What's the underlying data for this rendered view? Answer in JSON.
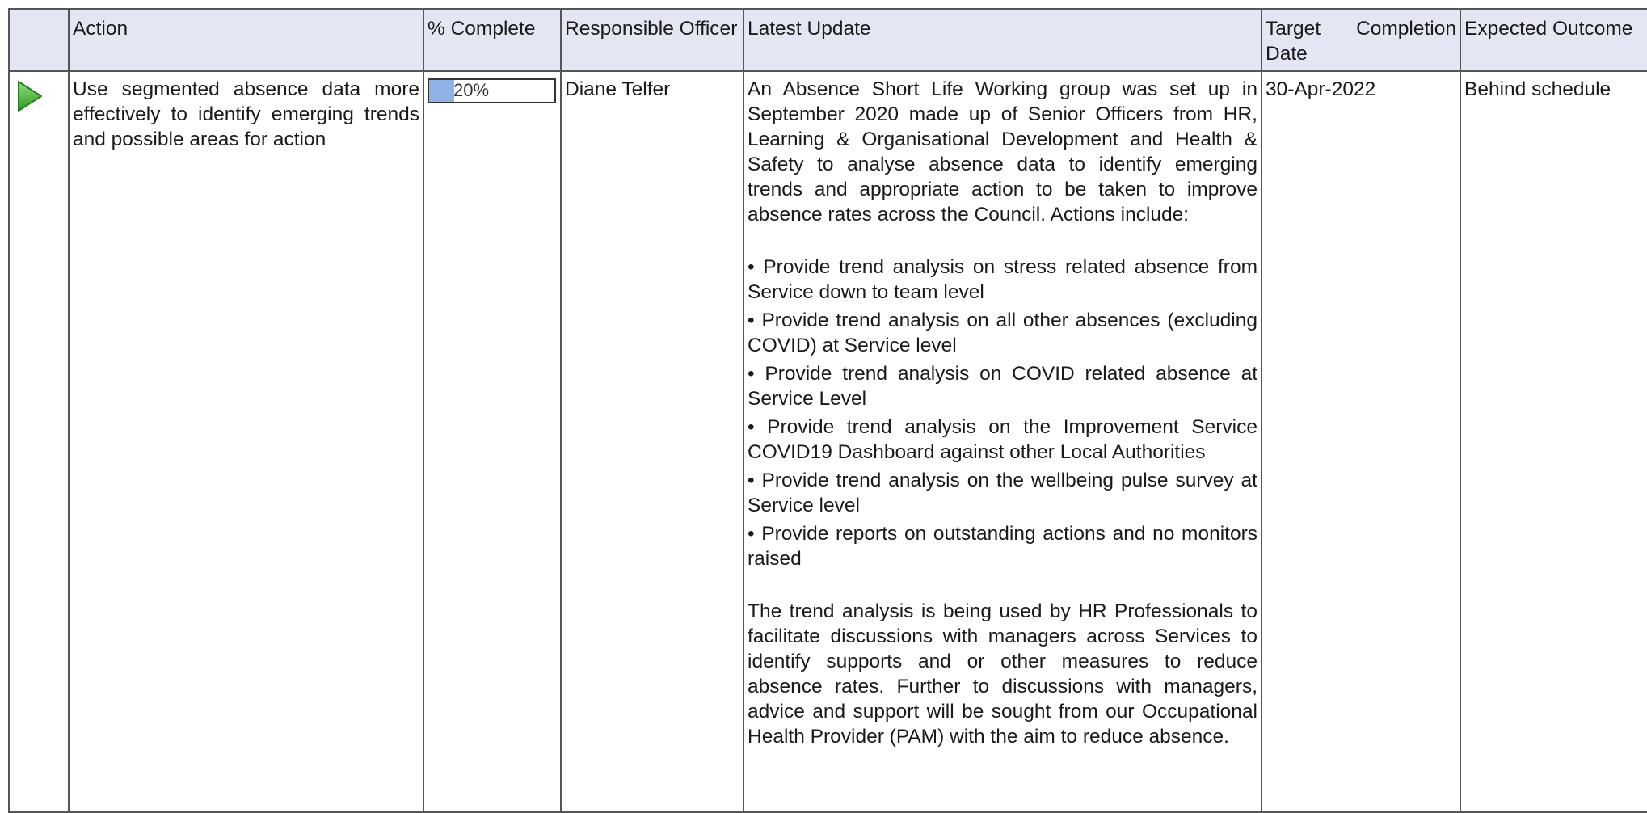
{
  "columns": {
    "status": "",
    "action": "Action",
    "complete": "% Complete",
    "officer": "Responsible Officer",
    "update": "Latest Update",
    "target": "Target Completion Date",
    "outcome": "Expected Outcome"
  },
  "row": {
    "status_icon": "play-icon",
    "status_color": "#4caf3a",
    "action": "Use segmented absence data more effectively to identify emerging trends and possible areas for action",
    "progress_percent": 20,
    "progress_label": "20%",
    "officer": "Diane Telfer",
    "update_intro": "An Absence Short Life Working group was set up in September 2020 made up of Senior Officers from HR, Learning & Organisational Development and Health & Safety to analyse absence data to identify emerging trends and appropriate action to be taken to improve absence rates across the Council.  Actions include:",
    "bullets": [
      "Provide trend analysis on stress related absence from Service down to team level",
      "Provide trend analysis on all other absences (excluding COVID) at Service level",
      "Provide trend analysis on COVID related absence at Service Level",
      "Provide trend analysis on the Improvement Service COVID19 Dashboard against other Local Authorities",
      "Provide trend analysis on the wellbeing pulse survey at Service level",
      "Provide reports on outstanding actions and no monitors raised"
    ],
    "update_outro": "The trend analysis is being used by HR Professionals to facilitate discussions with managers across Services to identify supports and or other measures to reduce absence rates.  Further to discussions with managers, advice and support will be sought from our Occupational Health Provider (PAM) with the aim to reduce absence.",
    "target_date": "30-Apr-2022",
    "outcome": "Behind schedule"
  },
  "colors": {
    "header_bg": "#e4e6f3",
    "progress_fill": "#8fb3e6",
    "border": "#555555"
  }
}
